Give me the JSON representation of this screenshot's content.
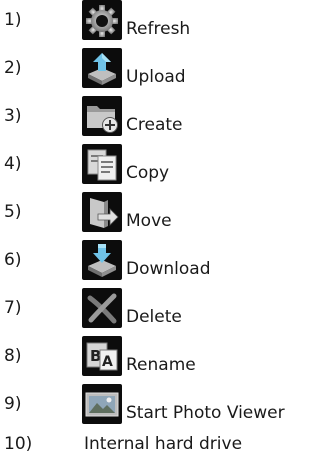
{
  "legend": {
    "items": [
      {
        "number": "1)",
        "label": "Refresh",
        "icon": "refresh-gear-icon"
      },
      {
        "number": "2)",
        "label": "Upload",
        "icon": "upload-icon"
      },
      {
        "number": "3)",
        "label": "Create",
        "icon": "create-folder-icon"
      },
      {
        "number": "4)",
        "label": "Copy",
        "icon": "copy-icon"
      },
      {
        "number": "5)",
        "label": "Move",
        "icon": "move-icon"
      },
      {
        "number": "6)",
        "label": "Download",
        "icon": "download-icon"
      },
      {
        "number": "7)",
        "label": "Delete",
        "icon": "delete-icon"
      },
      {
        "number": "8)",
        "label": "Rename",
        "icon": "rename-icon"
      },
      {
        "number": "9)",
        "label": "Start Photo Viewer",
        "icon": "photo-viewer-icon"
      },
      {
        "number": "10)",
        "label": "Internal hard drive"
      }
    ]
  }
}
